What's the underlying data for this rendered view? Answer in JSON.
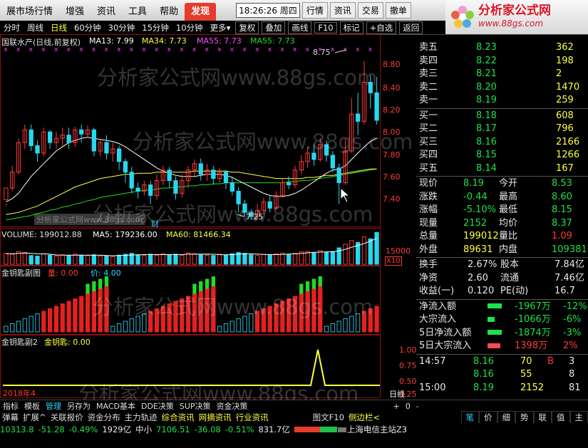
{
  "menu": {
    "items": [
      "展市场行情",
      "增强",
      "资讯",
      "工具",
      "帮助"
    ],
    "hot_item": "发现",
    "clock": "18:26:26 周四",
    "right_buttons": [
      "行情",
      "资讯",
      "交易",
      "撤单"
    ]
  },
  "logo": {
    "name": "分析家公式网",
    "url": "www.88gs.com",
    "subtitle": "国联水产"
  },
  "toolbar": {
    "items": [
      "分时",
      "周线",
      "日线",
      "60分钟",
      "30分钟",
      "15分钟",
      "10分钟",
      "更多"
    ],
    "selected": "日线",
    "more_icon": "caret-down",
    "buttons": [
      "复权",
      "叠加",
      "画线",
      "F10",
      "标记",
      "+自选",
      "返回"
    ]
  },
  "main_legend": {
    "title": "国联水产(日线,前复权)",
    "ma13": "MA13: 7.99",
    "ma34": "MA34: 7.73",
    "ma55a": "MA55: 7.73",
    "ma55b": "MA55: 7.73",
    "high_label": "8.75",
    "low_label": "7.25",
    "finance_marker": "财"
  },
  "volume_legend": {
    "volume": "VOLUME: 199012.88",
    "ma5": "MA5: 179236.00",
    "ma60": "MA60: 81466.34"
  },
  "ind1_legend": {
    "name": "金钥匙副图",
    "v1": "量: 0.00",
    "v2": "价: 4.00"
  },
  "ind2_legend": {
    "name": "金钥匙副2",
    "v1": "金钥匙: 0.00"
  },
  "axis": {
    "price_ticks": [
      "8.80",
      "8.40",
      "8.20",
      "8.00",
      "7.80",
      "7.60",
      "7.40"
    ],
    "volume_tick": "15000",
    "volume_unit": "X10",
    "ind2_ticks": [
      "1.00",
      "0.75",
      "0.50",
      "0.25"
    ],
    "year_label": "2018年4",
    "period_button": "日线",
    "period_controls": [
      "+",
      "0",
      "-"
    ]
  },
  "chart_data": {
    "type": "candlestick",
    "candles": [
      [
        7.44,
        7.55,
        7.4,
        7.38
      ],
      [
        7.55,
        7.7,
        7.52,
        7.76
      ],
      [
        7.7,
        7.98,
        7.68,
        8.02
      ],
      [
        7.98,
        8.1,
        7.92,
        8.15
      ],
      [
        8.1,
        7.95,
        7.9,
        8.15
      ],
      [
        7.95,
        7.88,
        7.8,
        8.0
      ],
      [
        7.88,
        8.08,
        7.85,
        8.12
      ],
      [
        8.08,
        7.98,
        7.92,
        8.1
      ],
      [
        7.98,
        8.02,
        7.92,
        8.08
      ],
      [
        8.02,
        8.05,
        7.95,
        8.12
      ],
      [
        8.05,
        7.98,
        7.92,
        8.12
      ],
      [
        7.98,
        8.1,
        7.94,
        8.13
      ],
      [
        8.1,
        8.06,
        7.98,
        8.15
      ],
      [
        8.06,
        8.1,
        8.02,
        8.14
      ],
      [
        8.1,
        7.9,
        7.85,
        8.12
      ],
      [
        7.9,
        7.98,
        7.85,
        8.0
      ],
      [
        7.98,
        7.88,
        7.82,
        8.05
      ],
      [
        7.88,
        7.92,
        7.8,
        7.98
      ],
      [
        7.92,
        7.8,
        7.72,
        7.95
      ],
      [
        7.8,
        7.7,
        7.6,
        7.83
      ],
      [
        7.7,
        7.55,
        7.5,
        7.75
      ],
      [
        7.55,
        7.52,
        7.45,
        7.6
      ],
      [
        7.52,
        7.58,
        7.48,
        7.62
      ],
      [
        7.58,
        7.48,
        7.4,
        7.62
      ],
      [
        7.48,
        7.62,
        7.44,
        7.68
      ],
      [
        7.62,
        7.72,
        7.58,
        7.76
      ],
      [
        7.72,
        7.62,
        7.55,
        7.75
      ],
      [
        7.62,
        7.5,
        7.44,
        7.66
      ],
      [
        7.5,
        7.62,
        7.46,
        7.68
      ],
      [
        7.62,
        7.72,
        7.55,
        7.76
      ],
      [
        7.72,
        7.78,
        7.66,
        7.82
      ],
      [
        7.78,
        7.68,
        7.62,
        7.83
      ],
      [
        7.68,
        7.72,
        7.62,
        7.78
      ],
      [
        7.72,
        7.64,
        7.58,
        7.76
      ],
      [
        7.64,
        7.7,
        7.6,
        7.74
      ],
      [
        7.7,
        7.6,
        7.54,
        7.72
      ],
      [
        7.6,
        7.52,
        7.48,
        7.66
      ],
      [
        7.52,
        7.4,
        7.32,
        7.56
      ],
      [
        7.4,
        7.32,
        7.28,
        7.44
      ],
      [
        7.32,
        7.28,
        7.25,
        7.35
      ],
      [
        7.28,
        7.34,
        7.25,
        7.4
      ],
      [
        7.34,
        7.42,
        7.3,
        7.46
      ],
      [
        7.42,
        7.36,
        7.32,
        7.48
      ],
      [
        7.36,
        7.48,
        7.34,
        7.52
      ],
      [
        7.48,
        7.6,
        7.46,
        7.64
      ],
      [
        7.6,
        7.58,
        7.54,
        7.66
      ],
      [
        7.58,
        7.72,
        7.55,
        7.76
      ],
      [
        7.72,
        7.8,
        7.68,
        7.86
      ],
      [
        7.8,
        7.88,
        7.74,
        7.94
      ],
      [
        7.88,
        7.82,
        7.76,
        7.96
      ],
      [
        7.82,
        7.96,
        7.8,
        8.02
      ],
      [
        7.96,
        7.86,
        7.8,
        8.0
      ],
      [
        7.86,
        7.74,
        7.7,
        7.9
      ],
      [
        7.74,
        7.6,
        7.4,
        7.78
      ],
      [
        7.6,
        7.9,
        7.58,
        8.02
      ],
      [
        7.9,
        8.25,
        7.88,
        8.4
      ],
      [
        8.25,
        8.18,
        8.05,
        8.45
      ],
      [
        8.18,
        8.55,
        8.15,
        8.75
      ],
      [
        8.55,
        8.45,
        8.3,
        8.62
      ],
      [
        8.45,
        8.19,
        8.15,
        8.6
      ]
    ],
    "ma13": [
      7.42,
      7.45,
      7.5,
      7.58,
      7.66,
      7.72,
      7.78,
      7.84,
      7.9,
      7.94,
      7.98,
      8.0,
      8.02,
      8.03,
      8.02,
      8.01,
      8.0,
      7.99,
      7.97,
      7.94,
      7.9,
      7.86,
      7.82,
      7.78,
      7.74,
      7.71,
      7.69,
      7.67,
      7.66,
      7.66,
      7.66,
      7.67,
      7.68,
      7.68,
      7.68,
      7.67,
      7.65,
      7.62,
      7.59,
      7.56,
      7.53,
      7.5,
      7.48,
      7.47,
      7.47,
      7.48,
      7.5,
      7.53,
      7.57,
      7.61,
      7.65,
      7.69,
      7.72,
      7.73,
      7.76,
      7.82,
      7.88,
      7.94,
      7.99,
      8.02
    ],
    "ma34": [
      7.3,
      7.31,
      7.32,
      7.34,
      7.36,
      7.38,
      7.41,
      7.44,
      7.47,
      7.5,
      7.53,
      7.56,
      7.58,
      7.6,
      7.62,
      7.64,
      7.65,
      7.66,
      7.67,
      7.68,
      7.68,
      7.69,
      7.69,
      7.69,
      7.7,
      7.7,
      7.7,
      7.7,
      7.7,
      7.7,
      7.71,
      7.71,
      7.71,
      7.71,
      7.71,
      7.71,
      7.7,
      7.7,
      7.69,
      7.68,
      7.67,
      7.66,
      7.65,
      7.64,
      7.64,
      7.64,
      7.64,
      7.64,
      7.65,
      7.65,
      7.66,
      7.67,
      7.67,
      7.68,
      7.69,
      7.7,
      7.71,
      7.72,
      7.73,
      7.73
    ],
    "ma55": [
      7.25,
      7.26,
      7.27,
      7.28,
      7.29,
      7.31,
      7.32,
      7.34,
      7.35,
      7.37,
      7.38,
      7.4,
      7.41,
      7.43,
      7.44,
      7.46,
      7.47,
      7.48,
      7.49,
      7.5,
      7.51,
      7.52,
      7.53,
      7.53,
      7.54,
      7.55,
      7.55,
      7.56,
      7.56,
      7.57,
      7.57,
      7.58,
      7.58,
      7.59,
      7.59,
      7.6,
      7.6,
      7.6,
      7.6,
      7.6,
      7.6,
      7.6,
      7.6,
      7.6,
      7.6,
      7.61,
      7.61,
      7.62,
      7.62,
      7.63,
      7.64,
      7.65,
      7.66,
      7.67,
      7.68,
      7.69,
      7.7,
      7.71,
      7.72,
      7.73
    ],
    "volume": [
      60,
      55,
      70,
      65,
      48,
      45,
      58,
      50,
      46,
      52,
      48,
      55,
      50,
      47,
      52,
      45,
      48,
      42,
      50,
      55,
      60,
      52,
      48,
      55,
      50,
      58,
      52,
      55,
      50,
      62,
      58,
      52,
      50,
      48,
      55,
      50,
      58,
      65,
      60,
      52,
      48,
      55,
      50,
      58,
      62,
      55,
      60,
      68,
      70,
      62,
      75,
      65,
      70,
      90,
      110,
      130,
      120,
      150,
      140,
      175
    ],
    "vol_ma5": [
      58,
      58,
      60,
      62,
      60,
      57,
      57,
      55,
      51,
      50,
      50,
      50,
      50,
      50,
      50,
      50,
      48,
      47,
      48,
      49,
      51,
      52,
      53,
      54,
      53,
      53,
      53,
      54,
      53,
      55,
      55,
      55,
      56,
      55,
      53,
      52,
      53,
      55,
      57,
      57,
      56,
      54,
      53,
      53,
      54,
      56,
      57,
      59,
      63,
      65,
      67,
      68,
      69,
      73,
      82,
      93,
      103,
      114,
      128,
      142
    ]
  },
  "quote": {
    "sell": [
      [
        "卖五",
        "8.23",
        "362"
      ],
      [
        "卖四",
        "8.22",
        "198"
      ],
      [
        "卖三",
        "8.21",
        "2"
      ],
      [
        "卖二",
        "8.20",
        "1470"
      ],
      [
        "卖一",
        "8.19",
        "259"
      ]
    ],
    "buy": [
      [
        "买一",
        "8.18",
        "608"
      ],
      [
        "买二",
        "8.17",
        "796"
      ],
      [
        "买三",
        "8.16",
        "2166"
      ],
      [
        "买四",
        "8.15",
        "1266"
      ],
      [
        "买五",
        "8.14",
        "167"
      ]
    ],
    "stats": [
      [
        "现价",
        "8.19",
        "今开",
        "8.53"
      ],
      [
        "涨跌",
        "-0.44",
        "最高",
        "8.60"
      ],
      [
        "涨幅",
        "-5.10%",
        "最低",
        "8.15"
      ],
      [
        "现量",
        "2152",
        "均价",
        "8.37"
      ],
      [
        "总量",
        "199012",
        "量比",
        "1.09"
      ],
      [
        "外盘",
        "89631",
        "内盘",
        "109381"
      ]
    ],
    "finance": [
      [
        "换手",
        "2.67%",
        "股本",
        "7.84亿"
      ],
      [
        "净资",
        "2.60",
        "流通",
        "7.46亿"
      ],
      [
        "收益(一)",
        "0.120",
        "PE(动)",
        "16.7"
      ]
    ],
    "flows": [
      [
        "净流入额",
        "-1967万",
        "-12%"
      ],
      [
        "大宗流入",
        "-1066万",
        "-6%"
      ],
      [
        "5日净流入额",
        "-1874万",
        "-3%"
      ],
      [
        "5日大宗流入",
        "1398万",
        "2%"
      ]
    ],
    "ticks": [
      [
        "14:57",
        "8.16",
        "70",
        "B",
        "3"
      ],
      [
        "",
        "8.16",
        "55",
        "",
        "8"
      ],
      [
        "15:00",
        "8.19",
        "2152",
        "",
        "81"
      ]
    ]
  },
  "tabs": {
    "items": [
      "指标",
      "模板",
      "管理",
      "另存为",
      "MACD基本",
      "DDE决策",
      "SUP决策",
      "资金决策"
    ],
    "selected": "管理",
    "right": [
      "图文F10",
      "侧边栏<"
    ]
  },
  "funcbar": {
    "items": [
      "弹幕",
      "扩展^",
      "关联报价",
      "资金分布",
      "主力轨迹",
      "综合资讯",
      "网摘资讯",
      "行业资讯"
    ],
    "highlighted": [
      "综合资讯",
      "网摘资讯",
      "行业资讯"
    ],
    "right": [
      "笔",
      "价",
      "细",
      "势",
      "联",
      "值",
      "主"
    ]
  },
  "status": {
    "index_value": "10313.8",
    "index_change": "-51.28",
    "index_pct": "-0.49%",
    "index_amount": "1929亿",
    "small_label": "中小",
    "small_value": "7106.51",
    "small_change": "-36.08",
    "small_pct": "-0.51%",
    "small_amount": "831.7亿",
    "server": "上海电信主站Z3"
  },
  "watermark": "分析家公式网www.88gs.com",
  "colors": {
    "up": "#ff3a3a",
    "down": "#27d8ef",
    "ma13": "#ffffff",
    "ma34": "#ffff40",
    "ma55": "#22dd22",
    "accent": "#e53b2c"
  }
}
